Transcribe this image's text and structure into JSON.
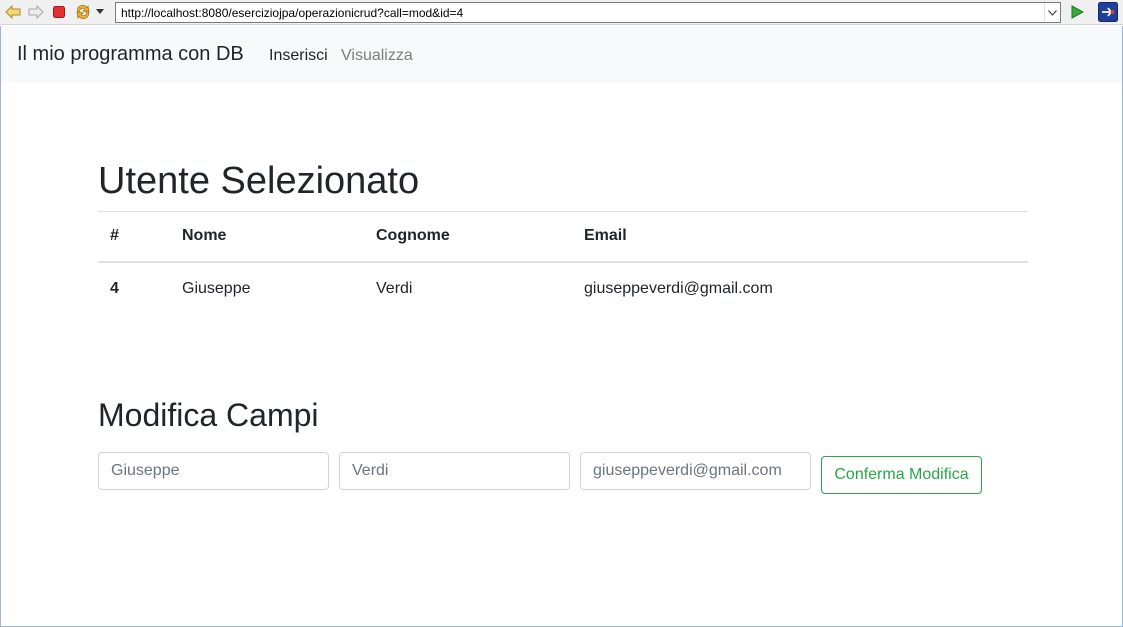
{
  "browser": {
    "url": "http://localhost:8080/eserciziojpa/operazionicrud?call=mod&id=4",
    "icons": [
      "back-icon",
      "forward-icon",
      "stop-icon",
      "refresh-icon",
      "menu-dropdown-icon",
      "address-dropdown-icon",
      "go-icon",
      "extension-icon"
    ]
  },
  "navbar": {
    "brand": "Il mio programma con DB",
    "links": [
      {
        "label": "Inserisci"
      },
      {
        "label": "Visualizza"
      }
    ]
  },
  "selected_user": {
    "title": "Utente Selezionato",
    "table": {
      "headers": [
        "#",
        "Nome",
        "Cognome",
        "Email"
      ],
      "rows": [
        [
          "4",
          "Giuseppe",
          "Verdi",
          "giuseppeverdi@gmail.com"
        ]
      ]
    }
  },
  "edit_form": {
    "title": "Modifica Campi",
    "fields": [
      {
        "placeholder": "Giuseppe"
      },
      {
        "placeholder": "Verdi"
      },
      {
        "placeholder": "giuseppeverdi@gmail.com"
      }
    ],
    "submit_label": "Conferma Modifica"
  },
  "colors": {
    "success": "#28a745",
    "navbar_bg": "#f8f9fa",
    "muted_link": "#7d7d7d"
  }
}
